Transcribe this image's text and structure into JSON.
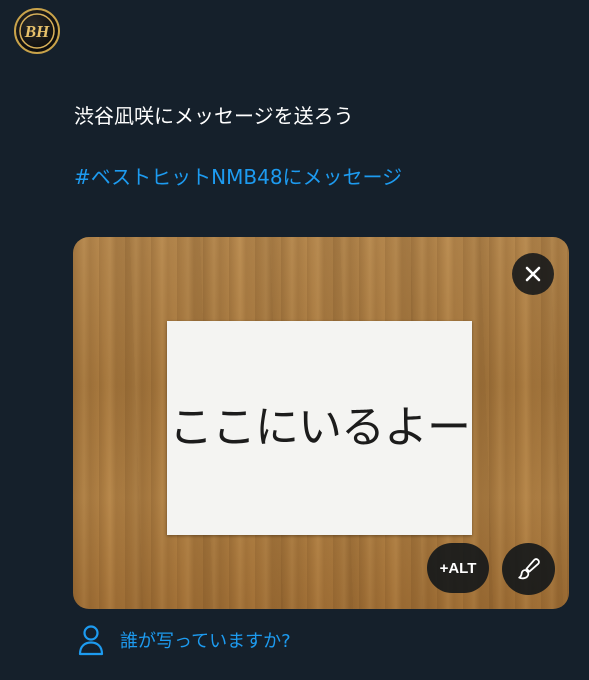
{
  "account": {
    "avatar_text": "BH",
    "avatar_icon": "bh-logo-icon"
  },
  "tweet": {
    "text": "渋谷凪咲にメッセージを送ろう",
    "hashtag": "#ベストヒットNMB48にメッセージ"
  },
  "media": {
    "paper_text": "ここにいるよー",
    "close_icon": "close-icon",
    "alt_label": "+ALT",
    "edit_icon": "paintbrush-icon"
  },
  "tag_people": {
    "icon": "person-icon",
    "label": "誰が写っていますか?"
  },
  "colors": {
    "background": "#15202b",
    "accent": "#1d9bf0",
    "text": "#ffffff",
    "avatar_ring": "#c9a34a"
  }
}
